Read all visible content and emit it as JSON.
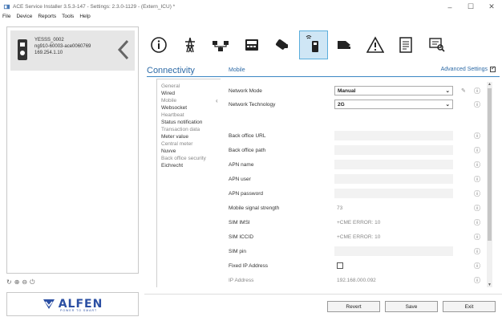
{
  "window": {
    "title": "ACE Service Installer 3.5.3-147 - Settings: 2.3.0-1129 - (Extern_ICU) *",
    "controls": [
      "–",
      "☐",
      "✕"
    ]
  },
  "menu": [
    "File",
    "Device",
    "Reports",
    "Tools",
    "Help"
  ],
  "device": {
    "name": "YESSS_0002",
    "id": "ng910-60003-ace0060769",
    "ip": "169.254.1.10"
  },
  "bottom_icons": [
    "refresh-icon",
    "add-icon",
    "remove-icon",
    "power-icon"
  ],
  "logo": {
    "text": "ALFEN",
    "tagline": "POWER TO SMART"
  },
  "toolbar": [
    {
      "name": "info-tool-icon",
      "active": false
    },
    {
      "name": "grid-tower-tool-icon",
      "active": false
    },
    {
      "name": "network-tool-icon",
      "active": false
    },
    {
      "name": "display-tool-icon",
      "active": false
    },
    {
      "name": "card-tool-icon",
      "active": false
    },
    {
      "name": "connectivity-tool-icon",
      "active": true
    },
    {
      "name": "cable-tool-icon",
      "active": false
    },
    {
      "name": "warning-tool-icon",
      "active": false
    },
    {
      "name": "document-tool-icon",
      "active": false
    },
    {
      "name": "search-screen-tool-icon",
      "active": false
    }
  ],
  "section": {
    "title": "Connectivity",
    "subtitle": "Mobile",
    "advanced_label": "Advanced Settings"
  },
  "categories": [
    {
      "label": "General",
      "dim": true
    },
    {
      "label": "Wired",
      "dim": false
    },
    {
      "label": "Mobile",
      "dim": true,
      "selected": true
    },
    {
      "label": "Websocket",
      "dim": false
    },
    {
      "label": "Heartbeat",
      "dim": true
    },
    {
      "label": "Status notification",
      "dim": false
    },
    {
      "label": "Transaction data",
      "dim": true
    },
    {
      "label": "Meter value",
      "dim": false
    },
    {
      "label": "Central meter",
      "dim": true
    },
    {
      "label": "Nuvve",
      "dim": false
    },
    {
      "label": "Back office security",
      "dim": true
    },
    {
      "label": "Eichrecht",
      "dim": false
    }
  ],
  "form": {
    "network_mode": {
      "label": "Network Mode",
      "value": "Manual"
    },
    "network_technology": {
      "label": "Network Technology",
      "value": "2G"
    },
    "back_office_url": {
      "label": "Back office URL",
      "value": ""
    },
    "back_office_path": {
      "label": "Back office path",
      "value": ""
    },
    "apn_name": {
      "label": "APN name",
      "value": ""
    },
    "apn_user": {
      "label": "APN user",
      "value": ""
    },
    "apn_password": {
      "label": "APN password",
      "value": ""
    },
    "signal_strength": {
      "label": "Mobile signal strength",
      "value": "73"
    },
    "sim_imsi": {
      "label": "SIM IMSI",
      "value": "+CME ERROR: 10"
    },
    "sim_iccid": {
      "label": "SIM ICCID",
      "value": "+CME ERROR: 10"
    },
    "sim_pin": {
      "label": "SIM pin",
      "value": ""
    },
    "fixed_ip": {
      "label": "Fixed IP Address",
      "checked": false
    },
    "ip_address": {
      "label": "IP Address",
      "value": "192.168.000.092"
    }
  },
  "buttons": {
    "revert": "Revert",
    "save": "Save",
    "exit": "Exit"
  },
  "colors": {
    "accent": "#2d6aa6",
    "active_tool_bg": "#cfe6f5",
    "logo": "#2b4fa3"
  }
}
